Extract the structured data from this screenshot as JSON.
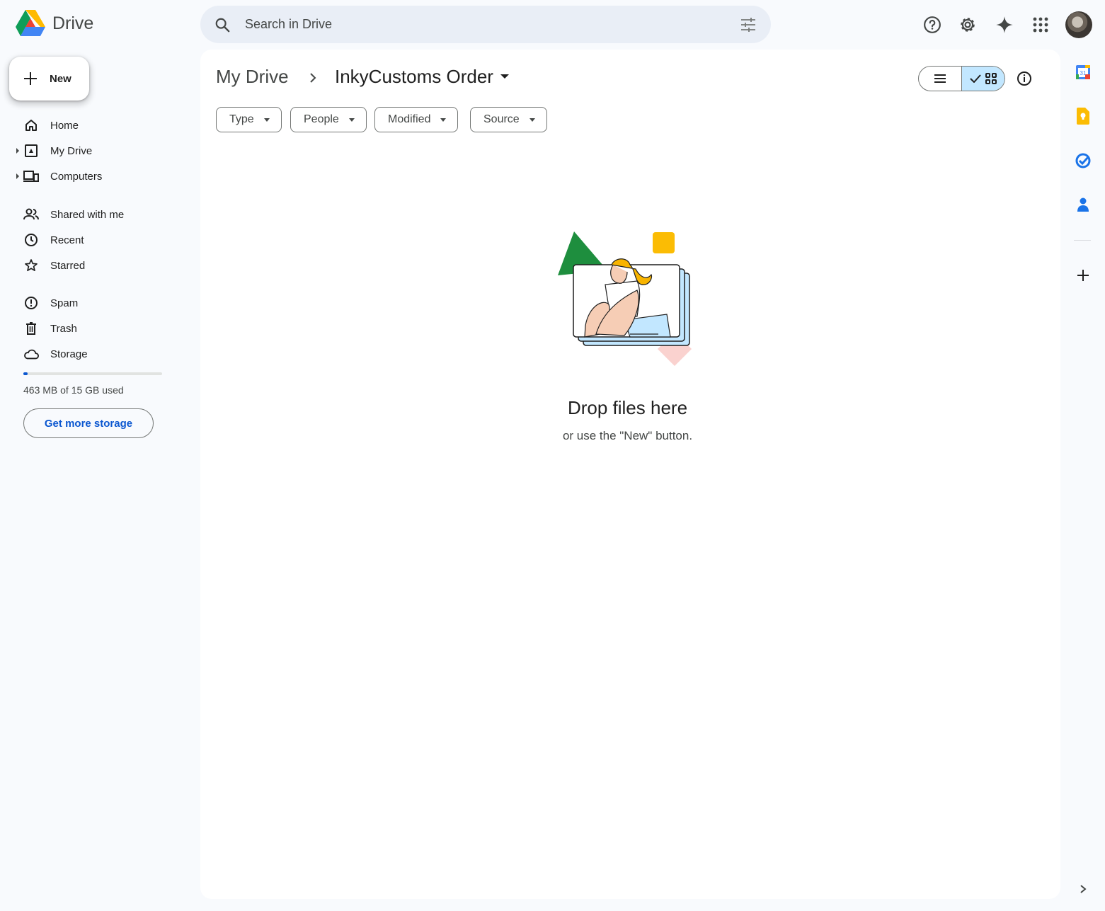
{
  "app": {
    "name": "Drive"
  },
  "search": {
    "placeholder": "Search in Drive"
  },
  "topbar": {
    "icons": [
      "help-icon",
      "settings-icon",
      "gemini-sparkle-icon",
      "apps-grid-icon",
      "account-avatar"
    ]
  },
  "new_button": {
    "label": "New"
  },
  "sidebar": {
    "items": [
      {
        "label": "Home",
        "icon": "home-icon"
      },
      {
        "label": "My Drive",
        "icon": "my-drive-icon"
      },
      {
        "label": "Computers",
        "icon": "computers-icon"
      },
      {
        "label": "Shared with me",
        "icon": "shared-icon"
      },
      {
        "label": "Recent",
        "icon": "clock-icon"
      },
      {
        "label": "Starred",
        "icon": "star-icon"
      },
      {
        "label": "Spam",
        "icon": "spam-icon"
      },
      {
        "label": "Trash",
        "icon": "trash-icon"
      },
      {
        "label": "Storage",
        "icon": "cloud-icon"
      }
    ],
    "storage": {
      "used_text": "463 MB of 15 GB used",
      "used_fraction": 0.03,
      "button_label": "Get more storage"
    }
  },
  "breadcrumb": {
    "root": "My Drive",
    "current": "InkyCustoms Order"
  },
  "filters": [
    "Type",
    "People",
    "Modified",
    "Source"
  ],
  "view": {
    "selected": "grid"
  },
  "empty_state": {
    "title": "Drop files here",
    "subtitle": "or use the \"New\" button."
  },
  "right_rail": [
    "calendar-icon",
    "keep-icon",
    "tasks-icon",
    "contacts-icon",
    "add-icon"
  ],
  "colors": {
    "accent": "#0b57d0",
    "toggle_selected": "#c2e7ff",
    "background": "#f8fafd"
  }
}
